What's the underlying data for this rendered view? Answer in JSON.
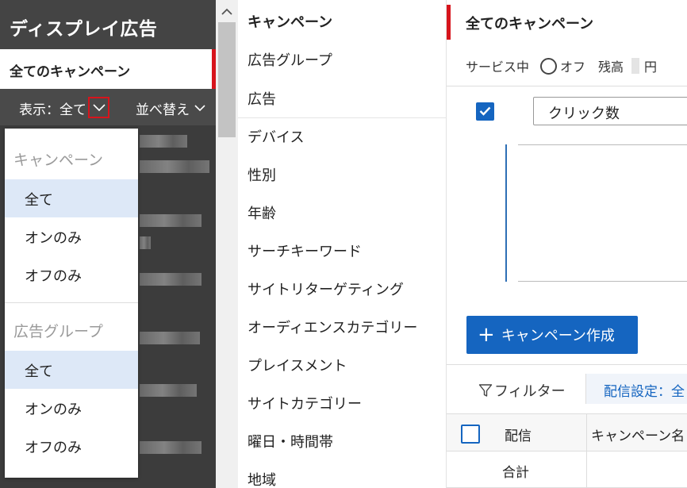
{
  "sidebar": {
    "title": "ディスプレイ広告",
    "current_selection": "全てのキャンペーン",
    "show_label": "表示：全て",
    "sort_label": "並べ替え"
  },
  "dropdown": {
    "sections": [
      {
        "header": "キャンペーン",
        "options": [
          "全て",
          "オンのみ",
          "オフのみ"
        ],
        "selected": "全て"
      },
      {
        "header": "広告グループ",
        "options": [
          "全て",
          "オンのみ",
          "オフのみ"
        ],
        "selected": "全て"
      }
    ]
  },
  "middle_nav": {
    "items": [
      {
        "label": "キャンペーン",
        "active": true
      },
      {
        "label": "広告グループ"
      },
      {
        "label": "広告"
      },
      {
        "label": "デバイス"
      },
      {
        "label": "性別"
      },
      {
        "label": "年齢"
      },
      {
        "label": "サーチキーワード"
      },
      {
        "label": "サイトリターゲティング"
      },
      {
        "label": "オーディエンスカテゴリー"
      },
      {
        "label": "プレイスメント"
      },
      {
        "label": "サイトカテゴリー"
      },
      {
        "label": "曜日・時間帯"
      },
      {
        "label": "地域"
      }
    ]
  },
  "main": {
    "title": "全てのキャンペーン",
    "status_service": "サービス中",
    "status_off": "オフ",
    "balance_label": "残高",
    "balance_currency": "円",
    "metric_select": "クリック数",
    "create_button": "キャンペーン作成",
    "filter_label": "フィルター",
    "delivery_setting": "配信設定：全",
    "table": {
      "columns": [
        "配信",
        "キャンペーン名"
      ],
      "total_row_label": "合計"
    }
  },
  "colors": {
    "accent_red": "#d7141c",
    "primary_blue": "#1565c0",
    "sidebar_dark": "#3c3c3c"
  }
}
